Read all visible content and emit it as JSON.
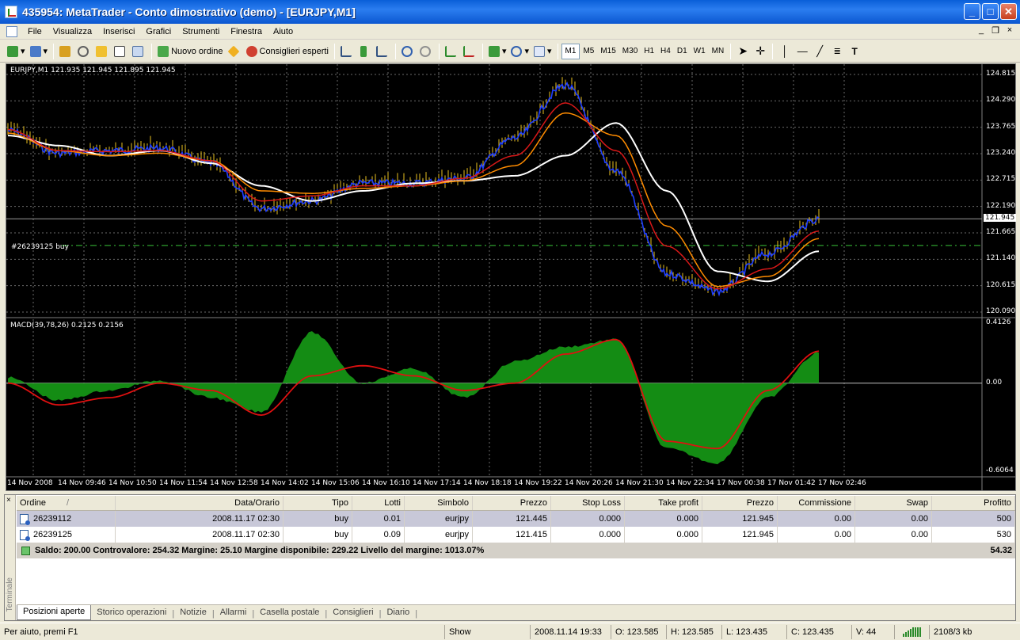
{
  "window": {
    "title": "435954: MetaTrader - Conto dimostrativo (demo) - [EURJPY,M1]",
    "buttons": {
      "minimize": "_",
      "maximize": "□",
      "close": "✕"
    }
  },
  "menu": {
    "items": [
      "File",
      "Visualizza",
      "Inserisci",
      "Grafici",
      "Strumenti",
      "Finestra",
      "Aiuto"
    ],
    "mdi": {
      "minimize": "_",
      "restore": "❐",
      "close": "×"
    }
  },
  "toolbar": {
    "new_order": "Nuovo ordine",
    "expert_advisors": "Consiglieri esperti",
    "timeframes": [
      "M1",
      "M5",
      "M15",
      "M30",
      "H1",
      "H4",
      "D1",
      "W1",
      "MN"
    ],
    "active_timeframe": "M1"
  },
  "chart": {
    "header": "EURJPY,M1  121.935 121.945 121.895 121.945",
    "order_line_label": "#26239125 buy",
    "macd_label": "MACD(39,78,26) 0.2125 0.2156",
    "price_ticks": [
      "124.815",
      "124.290",
      "123.765",
      "123.240",
      "122.715",
      "122.190",
      "121.665",
      "121.140",
      "120.615",
      "120.090"
    ],
    "current_price": "121.945",
    "macd_ticks": [
      "0.4126",
      "0.00",
      "-0.6064"
    ],
    "time_ticks": [
      "14 Nov 2008",
      "14 Nov 09:46",
      "14 Nov 10:50",
      "14 Nov 11:54",
      "14 Nov 12:58",
      "14 Nov 14:02",
      "14 Nov 15:06",
      "14 Nov 16:10",
      "14 Nov 17:14",
      "14 Nov 18:18",
      "14 Nov 19:22",
      "14 Nov 20:26",
      "14 Nov 21:30",
      "14 Nov 22:34",
      "17 Nov 00:38",
      "17 Nov 01:42",
      "17 Nov 02:46"
    ],
    "colors": {
      "background": "#000000",
      "price": "#1f3fff",
      "wick": "#e8c020",
      "ma_fast": "#d81818",
      "ma_mid": "#ff8c00",
      "ma_slow": "#ffffff",
      "macd_hist": "#148c14",
      "macd_signal": "#e01010",
      "order_line": "#2e9e2e"
    }
  },
  "chart_data": {
    "type": "line",
    "title": "EURJPY,M1",
    "x": [
      "14 Nov 2008",
      "14 Nov 09:46",
      "14 Nov 10:50",
      "14 Nov 11:54",
      "14 Nov 12:58",
      "14 Nov 14:02",
      "14 Nov 15:06",
      "14 Nov 16:10",
      "14 Nov 17:14",
      "14 Nov 18:18",
      "14 Nov 19:22",
      "14 Nov 20:26",
      "14 Nov 21:30",
      "14 Nov 22:34",
      "17 Nov 00:38",
      "17 Nov 01:42",
      "17 Nov 02:46"
    ],
    "series": [
      {
        "values": [
          123.7,
          123.25,
          123.3,
          123.35,
          123.05,
          122.15,
          122.3,
          122.65,
          122.65,
          122.75,
          123.55,
          124.6,
          122.9,
          120.85,
          120.5,
          121.25,
          121.94
        ]
      },
      {
        "values": [
          123.72,
          123.3,
          123.28,
          123.3,
          123.1,
          122.3,
          122.4,
          122.6,
          122.6,
          122.75,
          123.2,
          124.25,
          123.3,
          121.4,
          120.55,
          120.95,
          121.7
        ]
      },
      {
        "values": [
          123.65,
          123.3,
          123.2,
          123.25,
          123.1,
          122.5,
          122.45,
          122.55,
          122.6,
          122.7,
          123.0,
          124.05,
          123.6,
          121.8,
          120.6,
          120.8,
          121.55
        ]
      },
      {
        "values": [
          123.6,
          123.4,
          123.2,
          123.3,
          123.05,
          122.6,
          122.3,
          122.5,
          122.65,
          122.7,
          122.8,
          123.2,
          123.85,
          122.5,
          120.9,
          120.7,
          121.3
        ]
      },
      {
        "values": [
          0.04,
          -0.12,
          -0.05,
          0.02,
          -0.1,
          -0.2,
          0.35,
          0.0,
          0.1,
          -0.1,
          0.15,
          0.25,
          0.3,
          -0.45,
          -0.55,
          -0.1,
          0.21
        ]
      },
      {
        "values": [
          0.0,
          -0.15,
          -0.1,
          0.0,
          -0.05,
          -0.22,
          0.05,
          0.12,
          0.05,
          -0.05,
          0.0,
          0.2,
          0.3,
          -0.4,
          -0.45,
          -0.05,
          0.22
        ]
      }
    ],
    "ylim": [
      120.09,
      124.815
    ],
    "order_level": 121.415
  },
  "terminal": {
    "side_label": "Terminale",
    "columns": [
      "Ordine",
      "Data/Orario",
      "Tipo",
      "Lotti",
      "Simbolo",
      "Prezzo",
      "Stop Loss",
      "Take profit",
      "Prezzo",
      "Commissione",
      "Swap",
      "Profitto"
    ],
    "rows": [
      [
        "26239112",
        "2008.11.17 02:30",
        "buy",
        "0.01",
        "eurjpy",
        "121.445",
        "0.000",
        "0.000",
        "121.945",
        "0.00",
        "0.00",
        "500"
      ],
      [
        "26239125",
        "2008.11.17 02:30",
        "buy",
        "0.09",
        "eurjpy",
        "121.415",
        "0.000",
        "0.000",
        "121.945",
        "0.00",
        "0.00",
        "530"
      ]
    ],
    "balance_line": "Saldo: 200.00  Controvalore: 254.32  Margine: 25.10  Margine disponibile: 229.22  Livello del margine: 1013.07%",
    "total_profit": "54.32",
    "tabs": [
      "Posizioni aperte",
      "Storico operazioni",
      "Notizie",
      "Allarmi",
      "Casella postale",
      "Consiglieri",
      "Diario"
    ]
  },
  "status": {
    "help": "Per aiuto, premi F1",
    "profile": "Show",
    "datetime": "2008.11.14 19:33",
    "open": "O: 123.585",
    "high": "H: 123.585",
    "low": "L: 123.435",
    "close": "C: 123.435",
    "volume": "V: 44",
    "traffic": "2108/3 kb"
  }
}
